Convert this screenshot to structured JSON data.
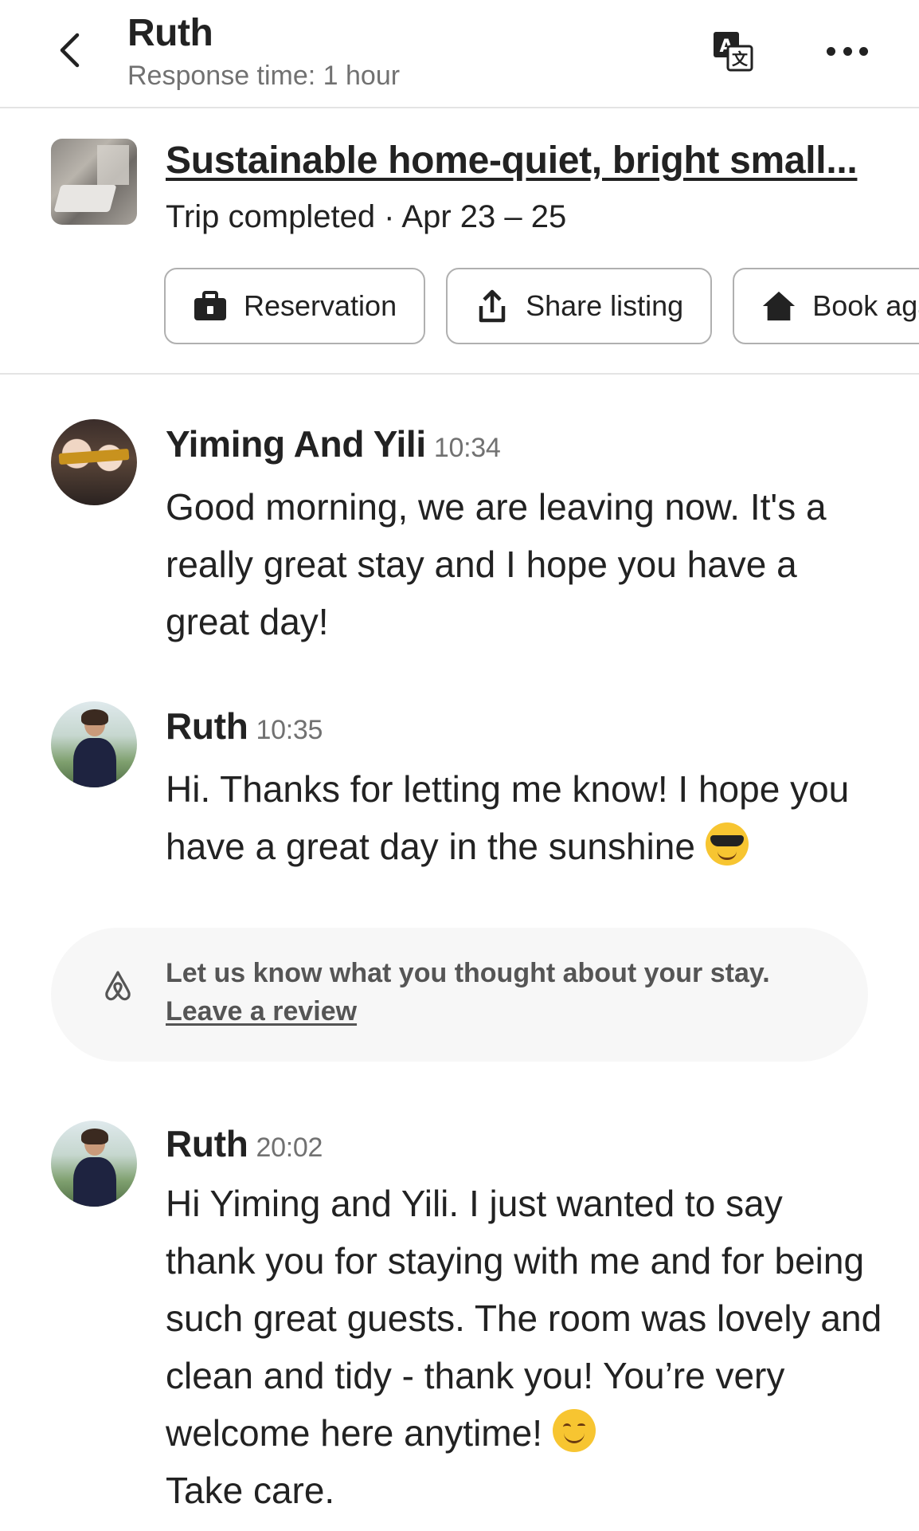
{
  "header": {
    "title": "Ruth",
    "subtitle": "Response time: 1 hour",
    "back_icon": "chevron-left-icon",
    "translate_icon": "translate-icon",
    "more_icon": "more-horizontal-icon"
  },
  "listing": {
    "title": "Sustainable home-quiet, bright small...",
    "meta": "Trip completed · Apr 23 – 25",
    "actions": [
      {
        "label": "Reservation",
        "icon": "suitcase-icon"
      },
      {
        "label": "Share listing",
        "icon": "share-icon"
      },
      {
        "label": "Book again",
        "icon": "home-icon"
      }
    ]
  },
  "messages": [
    {
      "sender": "Yiming And Yili",
      "time": "10:34",
      "text": "Good morning, we are leaving now. It's a really great stay and I hope you have a great day!"
    },
    {
      "sender": "Ruth",
      "time": "10:35",
      "text": "Hi.  Thanks for letting me know!  I hope you have a great day in the sunshine",
      "emoji": "smiling-face-with-sunglasses"
    },
    {
      "sender": "Ruth",
      "time": "20:02",
      "text_part1": "Hi Yiming and Yili.  I just wanted to say thank you for staying with me and for being such great guests.  The room was lovely and clean and tidy - thank you!  You’re very welcome here anytime!",
      "emoji": "smiling-face-with-smiling-eyes",
      "text_part2": "Take care."
    }
  ],
  "review_banner": {
    "icon": "airbnb-logo-icon",
    "prompt": "Let us know what you thought about your stay.",
    "link": "Leave a review"
  },
  "colors": {
    "text": "#222222",
    "secondary": "#717171",
    "border": "#b0b0b0",
    "banner_bg": "#f7f7f7"
  }
}
